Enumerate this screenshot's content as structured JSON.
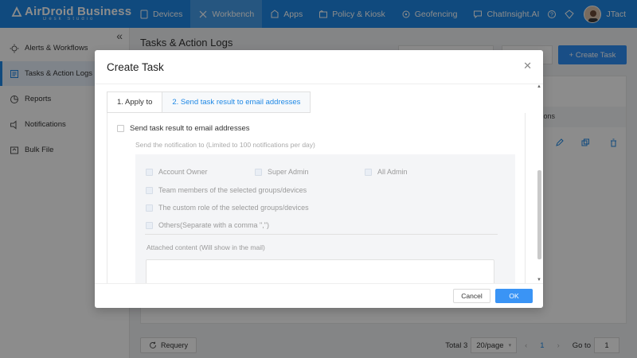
{
  "app": {
    "brand": "AirDroid Business",
    "brand_sub": "Desk Studio",
    "username": "JTact"
  },
  "nav": {
    "items": [
      {
        "label": "Devices",
        "icon": "tablet-icon"
      },
      {
        "label": "Workbench",
        "icon": "tools-icon"
      },
      {
        "label": "Apps",
        "icon": "apps-icon"
      },
      {
        "label": "Policy & Kiosk",
        "icon": "folder-icon"
      },
      {
        "label": "Geofencing",
        "icon": "geofence-icon"
      },
      {
        "label": "ChatInsight.AI",
        "icon": "chat-icon"
      }
    ],
    "active_index": 1
  },
  "sidebar": {
    "items": [
      {
        "label": "Alerts & Workflows",
        "icon": "alert-icon"
      },
      {
        "label": "Tasks & Action Logs",
        "icon": "tasks-icon"
      },
      {
        "label": "Reports",
        "icon": "reports-icon"
      },
      {
        "label": "Notifications",
        "icon": "notification-icon"
      },
      {
        "label": "Bulk File",
        "icon": "file-icon"
      }
    ],
    "active_index": 1
  },
  "main": {
    "page_title": "Tasks & Action Logs",
    "create_button": "+ Create Task",
    "partial_header": "tions",
    "requery": "Requery",
    "pagination": {
      "total": "Total 3",
      "per_page": "20/page",
      "current_page": "1",
      "goto_label": "Go to",
      "goto_value": "1"
    }
  },
  "modal": {
    "title": "Create Task",
    "tabs": [
      "1. Apply to",
      "2. Send task result to email addresses"
    ],
    "active_tab": 1,
    "send_checkbox_label": "Send task result to email addresses",
    "hint": "Send the notification to (Limited to 100 notifications per day)",
    "options": {
      "account_owner": "Account Owner",
      "super_admin": "Super Admin",
      "all_admin": "All Admin",
      "team_members": "Team members of the selected groups/devices",
      "custom_role": "The custom role of the selected groups/devices",
      "others": "Others(Separate with a comma \",\")"
    },
    "attached_label": "Attached content (Will show in the mail)",
    "cancel": "Cancel",
    "ok": "OK"
  },
  "colors": {
    "primary": "#1e88e5",
    "button": "#2e8ef4"
  }
}
